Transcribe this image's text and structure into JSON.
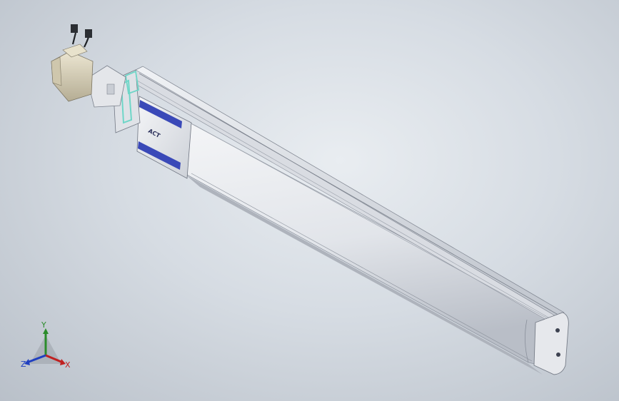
{
  "viewport": {
    "background_top": "#e9edf1",
    "background_bottom": "#b9c0c9"
  },
  "model": {
    "carriage_logo": "ACT",
    "colors": {
      "body": "#e8eaee",
      "body_shadow": "#b8bcc4",
      "rail_top": "#cfd3da",
      "accent_blue": "#3a49b8",
      "accent_cyan": "#6fd6c8",
      "motor": "#d8d0b8"
    }
  },
  "triad": {
    "x_label": "X",
    "y_label": "Y",
    "z_label": "Z",
    "x_color": "#c02020",
    "y_color": "#2b8c2b",
    "z_color": "#2040c0"
  }
}
